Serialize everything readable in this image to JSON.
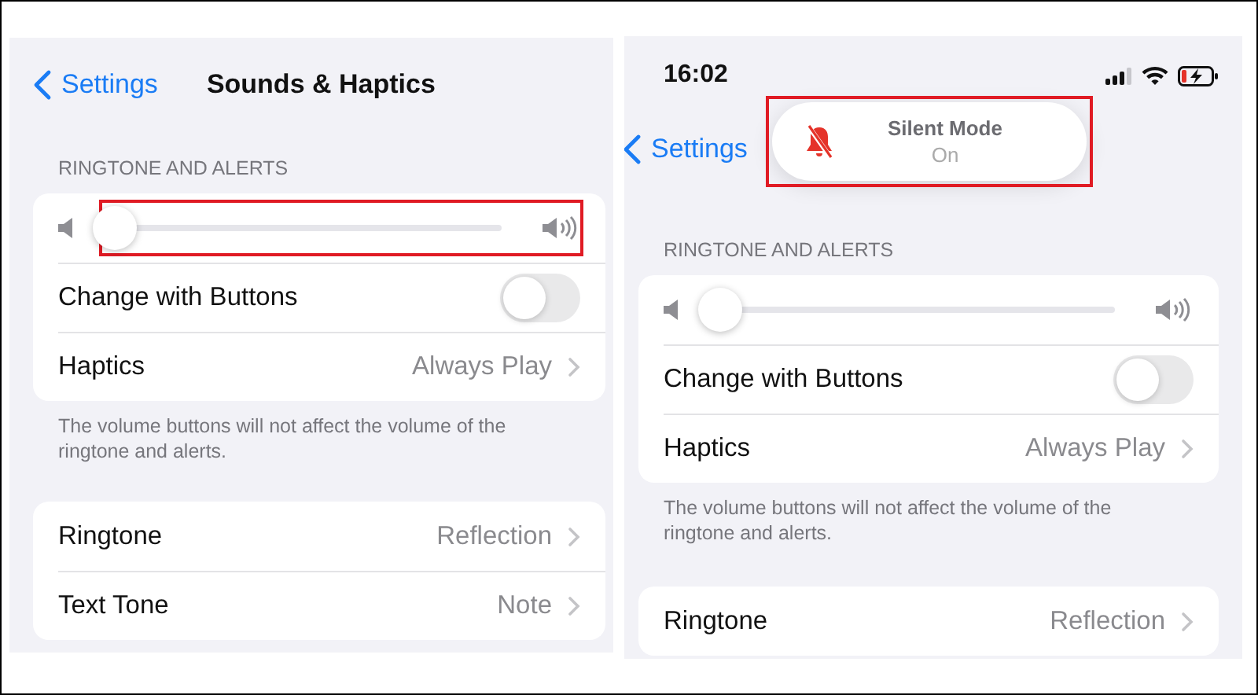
{
  "screens": [
    {
      "back": "Settings",
      "title": "Sounds & Haptics",
      "header": "RINGTONE AND ALERTS",
      "group1": [
        {
          "kind": "slider",
          "level": 0,
          "highlighted": true
        },
        {
          "kind": "toggle",
          "label": "Change with Buttons",
          "on": false
        },
        {
          "kind": "link",
          "label": "Haptics",
          "value": "Always Play"
        }
      ],
      "footer": "The volume buttons will not affect the volume of the ringtone and alerts.",
      "group2": [
        {
          "kind": "link",
          "label": "Ringtone",
          "value": "Reflection"
        },
        {
          "kind": "link",
          "label": "Text Tone",
          "value": "Note"
        }
      ]
    },
    {
      "status_bar": {
        "time": "16:02"
      },
      "back": "Settings",
      "toast": {
        "title": "Silent Mode",
        "value": "On",
        "highlighted": true
      },
      "header": "RINGTONE AND ALERTS",
      "group1": [
        {
          "kind": "slider",
          "level": 0,
          "highlighted": false
        },
        {
          "kind": "toggle",
          "label": "Change with Buttons",
          "on": false
        },
        {
          "kind": "link",
          "label": "Haptics",
          "value": "Always Play"
        }
      ],
      "footer": "The volume buttons will not affect the volume of the ringtone and alerts.",
      "group2": [
        {
          "kind": "link",
          "label": "Ringtone",
          "value": "Reflection"
        }
      ]
    }
  ]
}
